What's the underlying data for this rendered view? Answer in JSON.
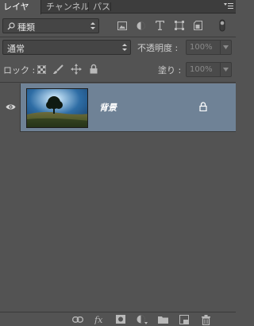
{
  "tabs": [
    {
      "label": "レイヤー",
      "active": true
    },
    {
      "label": "チャンネル",
      "active": false
    },
    {
      "label": "パス",
      "active": false
    }
  ],
  "filter": {
    "kind_label": "種類",
    "icons": [
      "image-filter-icon",
      "adjustment-filter-icon",
      "type-filter-icon",
      "shape-filter-icon",
      "smart-object-filter-icon",
      "filter-toggle-icon"
    ]
  },
  "blend": {
    "mode": "通常",
    "opacity_label": "不透明度 :",
    "opacity_value": "100%"
  },
  "lock": {
    "label": "ロック :",
    "icons": [
      "lock-transparent-pixels-icon",
      "lock-image-pixels-icon",
      "lock-position-icon",
      "lock-all-icon"
    ],
    "fill_label": "塗り :",
    "fill_value": "100%"
  },
  "layers": [
    {
      "name": "背景",
      "visible": true,
      "locked": true,
      "selected": true
    }
  ],
  "bottom_icons": [
    "link-layers-icon",
    "fx-icon",
    "add-mask-icon",
    "adjustment-layer-icon",
    "new-group-icon",
    "new-layer-icon",
    "delete-layer-icon"
  ],
  "colors": {
    "panel_bg": "#535353",
    "selected_row": "#6f8296",
    "tab_bar": "#3d3d3d"
  }
}
